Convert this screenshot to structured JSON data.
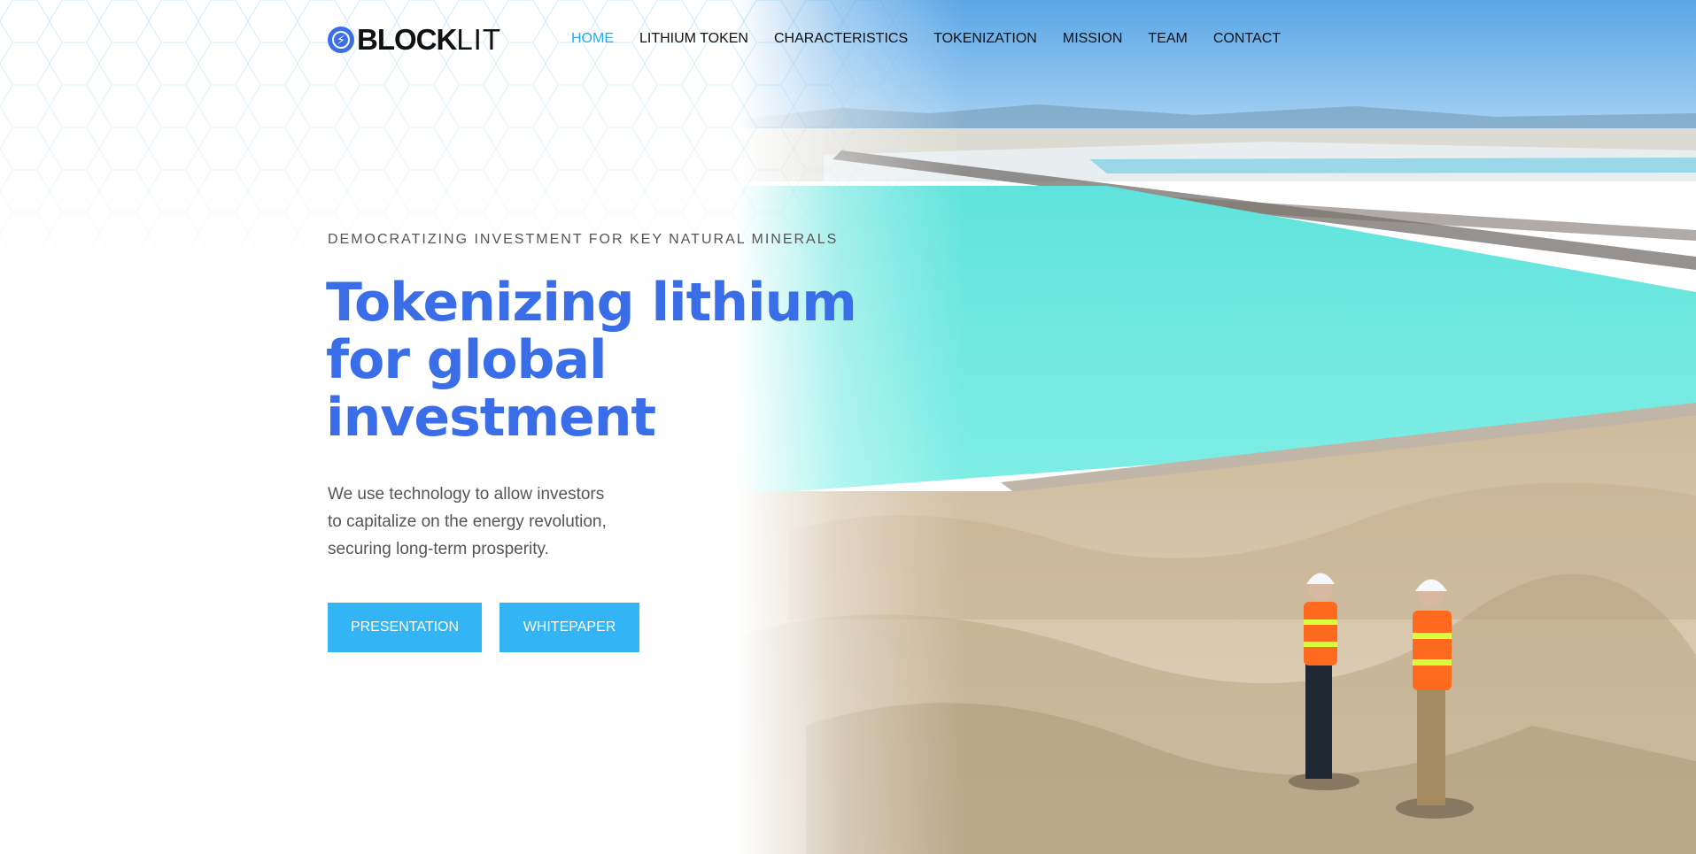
{
  "header": {
    "logo": {
      "part_bold": "BLOCK",
      "part_light": "LIT"
    },
    "nav": [
      {
        "label": "HOME",
        "active": true
      },
      {
        "label": "LITHIUM TOKEN",
        "active": false
      },
      {
        "label": "CHARACTERISTICS",
        "active": false
      },
      {
        "label": "TOKENIZATION",
        "active": false
      },
      {
        "label": "MISSION",
        "active": false
      },
      {
        "label": "TEAM",
        "active": false
      },
      {
        "label": "CONTACT",
        "active": false
      }
    ]
  },
  "hero": {
    "eyebrow": "DEMOCRATIZING INVESTMENT FOR KEY NATURAL MINERALS",
    "headline_lines": [
      "Tokenizing lithium",
      "for global",
      "investment"
    ],
    "lead_lines": [
      "We use technology to allow investors",
      "to capitalize on the energy revolution,",
      "securing long-term prosperity."
    ],
    "buttons": {
      "presentation": "PRESENTATION",
      "whitepaper": "WHITEPAPER"
    }
  },
  "colors": {
    "accent_blue": "#3a6ee8",
    "nav_active": "#29a8f0",
    "button_bg": "#33b5f5",
    "text_gray": "#555555"
  },
  "icons": {
    "logo_mark": "lightning-bolt-circle-icon"
  }
}
